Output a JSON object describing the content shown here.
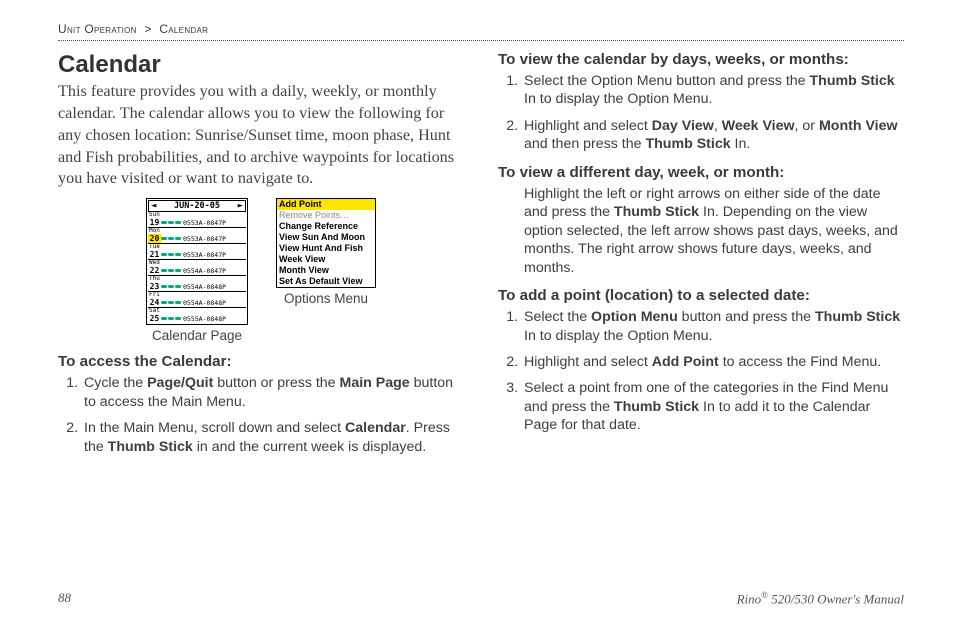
{
  "breadcrumb": {
    "part1": "Unit Operation",
    "sep": ">",
    "part2": "Calendar"
  },
  "title": "Calendar",
  "intro": "This feature provides you with a daily, weekly, or monthly calendar. The calendar allows you to view the following for any chosen location: Sunrise/Sunset time, moon phase, Hunt and Fish probabilities, and to archive waypoints for locations you have visited or want to navigate to.",
  "figures": {
    "calendar_caption": "Calendar Page",
    "options_caption": "Options Menu",
    "calendar": {
      "header_date": "JUN-20-05",
      "rows": [
        {
          "day": "Sun",
          "num": "19",
          "time": "0553A-0847P",
          "hl": false
        },
        {
          "day": "Mon",
          "num": "20",
          "time": "0553A-0847P",
          "hl": true
        },
        {
          "day": "Tue",
          "num": "21",
          "time": "0553A-0847P",
          "hl": false
        },
        {
          "day": "Wed",
          "num": "22",
          "time": "0554A-0847P",
          "hl": false
        },
        {
          "day": "Thu",
          "num": "23",
          "time": "0554A-0848P",
          "hl": false
        },
        {
          "day": "Fri",
          "num": "24",
          "time": "0554A-0848P",
          "hl": false
        },
        {
          "day": "Sat",
          "num": "25",
          "time": "0555A-0848P",
          "hl": false
        }
      ]
    },
    "options": [
      {
        "label": "Add Point",
        "hl": true
      },
      {
        "label": "Remove Points…",
        "dim": true
      },
      {
        "label": "Change Reference"
      },
      {
        "label": "View Sun And Moon"
      },
      {
        "label": "View Hunt And Fish"
      },
      {
        "label": "Week View"
      },
      {
        "label": "Month View"
      },
      {
        "label": "Set As Default View"
      }
    ]
  },
  "access": {
    "heading": "To access the Calendar:",
    "s1a": "Cycle the ",
    "s1b": "Page/Quit",
    "s1c": " button or press the ",
    "s1d": "Main Page",
    "s1e": " button to access the Main Menu.",
    "s2a": "In the Main Menu, scroll down and select ",
    "s2b": "Calendar",
    "s2c": ". Press the ",
    "s2d": "Thumb Stick",
    "s2e": " in and the current week is displayed."
  },
  "viewby": {
    "heading": "To view the calendar by days, weeks, or months:",
    "s1a": "Select the Option Menu button and press the ",
    "s1b": "Thumb Stick",
    "s1c": " In to display the Option Menu.",
    "s2a": "Highlight and select ",
    "s2b": "Day View",
    "s2c": ",  ",
    "s2d": "Week View",
    "s2e": ", or ",
    "s2f": "Month View",
    "s2g": " and then press the ",
    "s2h": "Thumb Stick",
    "s2i": " In."
  },
  "viewdiff": {
    "heading": "To view a different day, week, or month:",
    "pa": "Highlight the left or right arrows on either side of the date and press the ",
    "pb": "Thumb Stick",
    "pc": " In. Depending on the view option selected, the left arrow shows past days, weeks, and months. The right arrow shows future days, weeks, and months."
  },
  "addpoint": {
    "heading": "To add a point (location) to a selected date:",
    "s1a": "Select the ",
    "s1b": "Option Menu",
    "s1c": " button and press the ",
    "s1d": "Thumb Stick",
    "s1e": " In to display the Option Menu.",
    "s2a": "Highlight and select ",
    "s2b": "Add Point",
    "s2c": " to access the Find Menu.",
    "s3a": "Select a point from one of the categories in the Find Menu and press the ",
    "s3b": "Thumb Stick",
    "s3c": " In to add it to the Calendar Page for that date."
  },
  "footer": {
    "page": "88",
    "doc1": "Rino",
    "doc_sup": "®",
    "doc2": " 520/530 Owner's Manual"
  }
}
